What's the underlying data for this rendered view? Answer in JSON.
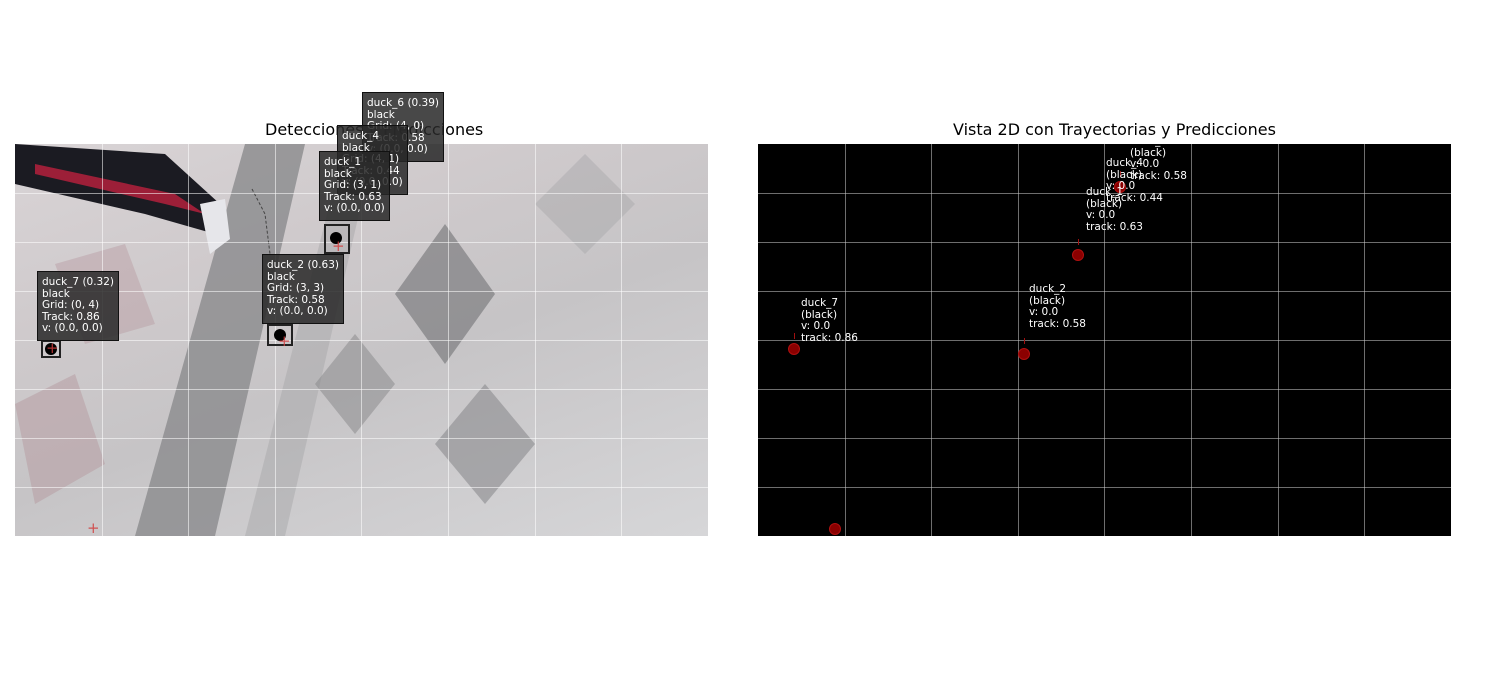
{
  "panels": {
    "left_title": "Detecciones y Predicciones",
    "right_title": "Vista 2D con Trayectorias y Predicciones"
  },
  "colors": {
    "map_background": "#000000",
    "track_point": "#8b0000",
    "prediction": "#d23c3c",
    "label_box": "#2b2b2b",
    "label_text": "#ffffff"
  },
  "chart_data": [
    {
      "type": "scatter",
      "title": "Detecciones y Predicciones",
      "background": "camera frame (floor tiles)",
      "grid": true,
      "detections": [
        {
          "id": "duck_6",
          "score": "0.39",
          "lines": [
            "duck_6 (0.39)",
            "black",
            "Grid: (4, 0)",
            "Track: 0.58",
            "v: (0.0, 0.0)"
          ]
        },
        {
          "id": "duck_4",
          "lines": [
            "duck_4",
            "black",
            "Grid: (4, 1)",
            "Track: 0.44",
            "v: (0.0, 0.0)"
          ]
        },
        {
          "id": "duck_1",
          "lines": [
            "duck_1",
            "black",
            "Grid: (3, 1)",
            "Track: 0.63",
            "v: (0.0, 0.0)"
          ]
        },
        {
          "id": "duck_2",
          "score": "0.63",
          "lines": [
            "duck_2 (0.63)",
            "black",
            "Grid: (3, 3)",
            "Track: 0.58",
            "v: (0.0, 0.0)"
          ]
        },
        {
          "id": "duck_7",
          "score": "0.32",
          "lines": [
            "duck_7 (0.32)",
            "black",
            "Grid: (0, 4)",
            "Track: 0.86",
            "v: (0.0, 0.0)"
          ]
        }
      ]
    },
    {
      "type": "scatter",
      "title": "Vista 2D con Trayectorias y Predicciones",
      "grid": true,
      "tracks": [
        {
          "id": "duck_6",
          "lines": [
            "duck_6",
            "(black)",
            "v: 0.0",
            "track: 0.58"
          ]
        },
        {
          "id": "duck_4",
          "lines": [
            "duck_4",
            "(black)",
            "v: 0.0",
            "track: 0.44"
          ]
        },
        {
          "id": "duck_1",
          "lines": [
            "duck_1",
            "(black)",
            "v: 0.0",
            "track: 0.63"
          ]
        },
        {
          "id": "duck_2",
          "lines": [
            "duck_2",
            "(black)",
            "v: 0.0",
            "track: 0.58"
          ]
        },
        {
          "id": "duck_7",
          "lines": [
            "duck_7",
            "(black)",
            "v: 0.0",
            "track: 0.86"
          ]
        }
      ]
    }
  ]
}
